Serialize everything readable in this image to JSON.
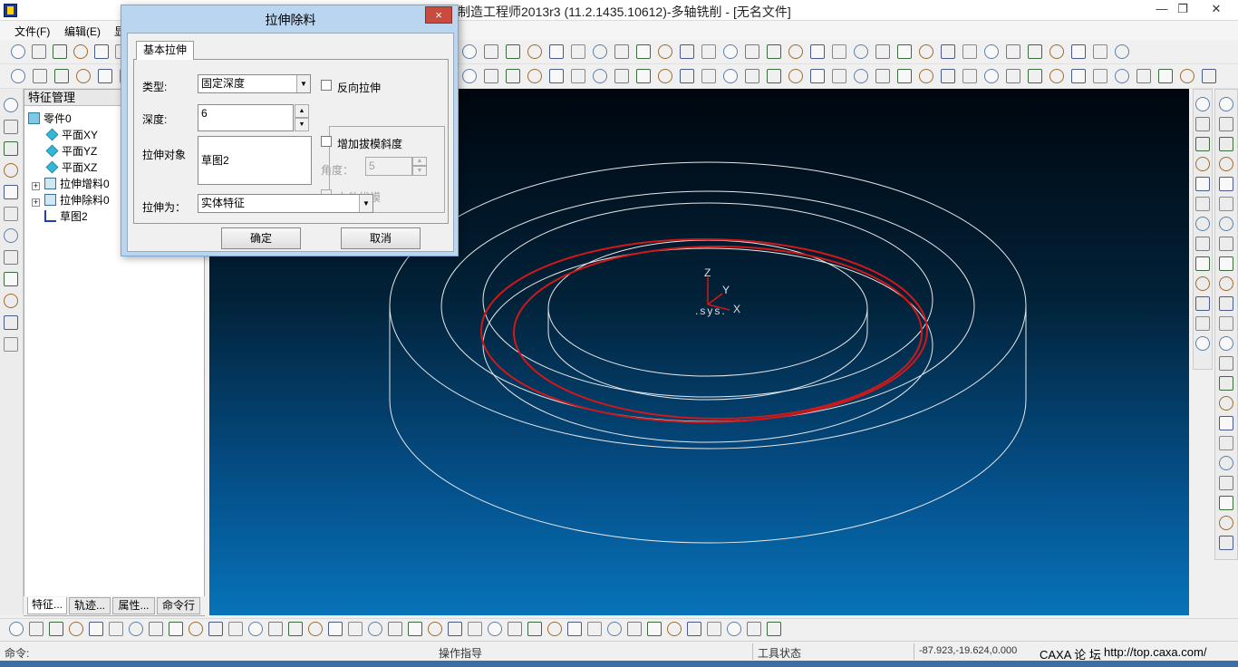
{
  "window": {
    "title": "制造工程师2013r3 (11.2.1435.10612)-多轴铣削 - [无名文件]",
    "min_icon": "minimize-icon",
    "max_icon": "restore-icon",
    "close_icon": "close-icon"
  },
  "menu": [
    "文件(F)",
    "编辑(E)",
    "显"
  ],
  "tree": {
    "header": "特征管理",
    "nodes": [
      {
        "label": "零件0",
        "icon": "part-icon"
      },
      {
        "label": "平面XY",
        "icon": "plane-icon"
      },
      {
        "label": "平面YZ",
        "icon": "plane-icon"
      },
      {
        "label": "平面XZ",
        "icon": "plane-icon"
      },
      {
        "label": "拉伸增料0",
        "icon": "extrude-add-icon"
      },
      {
        "label": "拉伸除料0",
        "icon": "extrude-cut-icon"
      },
      {
        "label": "草图2",
        "icon": "sketch-icon"
      }
    ],
    "tabs": [
      "特征...",
      "轨迹...",
      "属性...",
      "命令行"
    ]
  },
  "dialog": {
    "title": "拉伸除料",
    "close_label": "×",
    "tab": "基本拉伸",
    "type_label": "类型:",
    "type_value": "固定深度",
    "reverse_label": "反向拉伸",
    "depth_label": "深度:",
    "depth_value": "6",
    "draft_label": "增加拔模斜度",
    "angle_label": "角度：",
    "angle_value": "5",
    "outward_label": "向外拔模",
    "object_label": "拉伸对象",
    "object_value": "草图2",
    "as_label": "拉伸为：",
    "as_value": "实体特征",
    "ok_label": "确定",
    "cancel_label": "取消"
  },
  "viewport": {
    "axis_z": "Z",
    "axis_y": "Y",
    "axis_x": "X",
    "axis_origin": ".sys.",
    "colors": {
      "wire": "#e8e8e8",
      "highlight": "#d01818"
    }
  },
  "status": {
    "command_label": "命令:",
    "guide_label": "操作指导",
    "tool_state_label": "工具状态",
    "coordinates": "-87.923,-19.624,0.000",
    "forum_label": "CAXA 论 坛",
    "forum_url": "http://top.caxa.com/"
  }
}
